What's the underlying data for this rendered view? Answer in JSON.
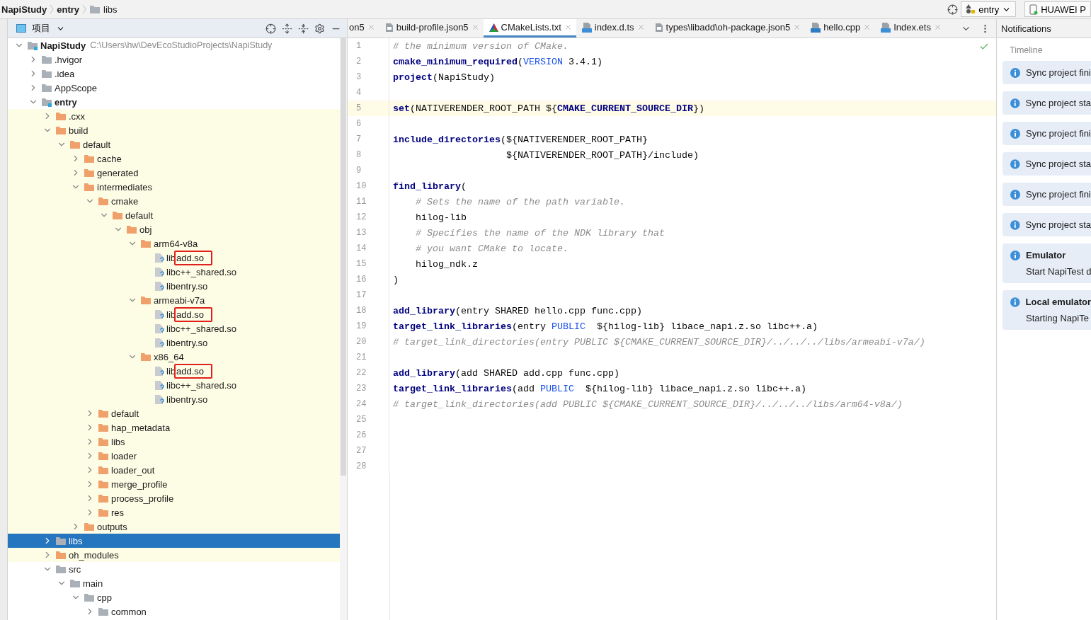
{
  "breadcrumb": [
    {
      "label": "NapiStudy",
      "kind": "text"
    },
    {
      "label": "entry",
      "kind": "text"
    },
    {
      "label": "libs",
      "kind": "folder"
    }
  ],
  "run_config": {
    "label": "entry"
  },
  "device": {
    "label": "HUAWEI P"
  },
  "project_panel": {
    "title": "项目",
    "tree": [
      {
        "label": "NapiStudy",
        "kind": "project",
        "path": "C:\\Users\\hw\\DevEcoStudioProjects\\NapiStudy",
        "expanded": true,
        "children": [
          {
            "label": ".hvigor",
            "kind": "folder",
            "expanded": false
          },
          {
            "label": ".idea",
            "kind": "folder",
            "expanded": false
          },
          {
            "label": "AppScope",
            "kind": "folder",
            "expanded": false
          },
          {
            "label": "entry",
            "kind": "module",
            "expanded": true,
            "children": [
              {
                "label": ".cxx",
                "kind": "excluded",
                "highlighted": true,
                "expanded": false
              },
              {
                "label": "build",
                "kind": "excluded",
                "highlighted": true,
                "expanded": true,
                "children": [
                  {
                    "label": "default",
                    "kind": "excluded",
                    "expanded": true,
                    "children": [
                      {
                        "label": "cache",
                        "kind": "excluded",
                        "expanded": false
                      },
                      {
                        "label": "generated",
                        "kind": "excluded",
                        "expanded": false
                      },
                      {
                        "label": "intermediates",
                        "kind": "excluded",
                        "expanded": true,
                        "children": [
                          {
                            "label": "cmake",
                            "kind": "excluded",
                            "expanded": true,
                            "children": [
                              {
                                "label": "default",
                                "kind": "excluded",
                                "expanded": true,
                                "children": [
                                  {
                                    "label": "obj",
                                    "kind": "excluded",
                                    "expanded": true,
                                    "children": [
                                      {
                                        "label": "arm64-v8a",
                                        "kind": "excluded",
                                        "expanded": true,
                                        "children": [
                                          {
                                            "label": "lib",
                                            "boxed": "add.so",
                                            "kind": "file"
                                          },
                                          {
                                            "label": "libc++_shared.so",
                                            "kind": "file"
                                          },
                                          {
                                            "label": "libentry.so",
                                            "kind": "file"
                                          }
                                        ]
                                      },
                                      {
                                        "label": "armeabi-v7a",
                                        "kind": "excluded",
                                        "expanded": true,
                                        "children": [
                                          {
                                            "label": "lib",
                                            "boxed": "add.so",
                                            "kind": "file"
                                          },
                                          {
                                            "label": "libc++_shared.so",
                                            "kind": "file"
                                          },
                                          {
                                            "label": "libentry.so",
                                            "kind": "file"
                                          }
                                        ]
                                      },
                                      {
                                        "label": "x86_64",
                                        "kind": "excluded",
                                        "expanded": true,
                                        "children": [
                                          {
                                            "label": "lib",
                                            "boxed": "add.so",
                                            "kind": "file"
                                          },
                                          {
                                            "label": "libc++_shared.so",
                                            "kind": "file"
                                          },
                                          {
                                            "label": "libentry.so",
                                            "kind": "file"
                                          }
                                        ]
                                      }
                                    ]
                                  }
                                ]
                              }
                            ]
                          },
                          {
                            "label": "default",
                            "kind": "excluded",
                            "expanded": false
                          },
                          {
                            "label": "hap_metadata",
                            "kind": "excluded",
                            "expanded": false
                          },
                          {
                            "label": "libs",
                            "kind": "excluded",
                            "expanded": false
                          },
                          {
                            "label": "loader",
                            "kind": "excluded",
                            "expanded": false
                          },
                          {
                            "label": "loader_out",
                            "kind": "excluded",
                            "expanded": false
                          },
                          {
                            "label": "merge_profile",
                            "kind": "excluded",
                            "expanded": false
                          },
                          {
                            "label": "process_profile",
                            "kind": "excluded",
                            "expanded": false
                          },
                          {
                            "label": "res",
                            "kind": "excluded",
                            "expanded": false
                          }
                        ]
                      },
                      {
                        "label": "outputs",
                        "kind": "excluded",
                        "expanded": false
                      }
                    ]
                  }
                ]
              },
              {
                "label": "libs",
                "kind": "folder",
                "expanded": false,
                "selected": true
              },
              {
                "label": "oh_modules",
                "kind": "excluded",
                "highlighted": true,
                "expanded": false
              },
              {
                "label": "src",
                "kind": "folder",
                "expanded": true,
                "children": [
                  {
                    "label": "main",
                    "kind": "folder",
                    "expanded": true,
                    "children": [
                      {
                        "label": "cpp",
                        "kind": "folder",
                        "expanded": true,
                        "children": [
                          {
                            "label": "common",
                            "kind": "folder",
                            "expanded": false
                          }
                        ]
                      }
                    ]
                  }
                ]
              }
            ]
          }
        ]
      }
    ]
  },
  "editor_tabs": [
    {
      "label": "on5",
      "kind": "plain",
      "selected": false
    },
    {
      "label": "build-profile.json5",
      "kind": "json",
      "selected": false
    },
    {
      "label": "CMakeLists.txt",
      "kind": "cmake",
      "selected": true
    },
    {
      "label": "index.d.ts",
      "kind": "ts",
      "selected": false
    },
    {
      "label": "types\\libadd\\oh-package.json5",
      "kind": "json",
      "selected": false
    },
    {
      "label": "hello.cpp",
      "kind": "cpp",
      "selected": false
    },
    {
      "label": "Index.ets",
      "kind": "ets",
      "selected": false
    }
  ],
  "code": [
    {
      "number": "1",
      "tokens": [
        {
          "t": "# the minimum version of CMake.",
          "kind": "comment"
        }
      ]
    },
    {
      "number": "2",
      "tokens": [
        {
          "t": "cmake_minimum_required",
          "kind": "keyword"
        },
        {
          "t": "(",
          "kind": "text"
        },
        {
          "t": "VERSION",
          "kind": "constant"
        },
        {
          "t": " 3.4.1)",
          "kind": "text"
        }
      ]
    },
    {
      "number": "3",
      "tokens": [
        {
          "t": "project",
          "kind": "keyword"
        },
        {
          "t": "(NapiStudy)",
          "kind": "text"
        }
      ]
    },
    {
      "number": "4"
    },
    {
      "number": "5",
      "current": true,
      "tokens": [
        {
          "t": "set",
          "kind": "keyword"
        },
        {
          "t": "(NATIVERENDER_ROOT_PATH ${",
          "kind": "text"
        },
        {
          "t": "CMAKE_CURRENT_SOURCE_DIR",
          "kind": "variable"
        },
        {
          "t": "})",
          "kind": "text"
        }
      ]
    },
    {
      "number": "6"
    },
    {
      "number": "7",
      "tokens": [
        {
          "t": "include_directories",
          "kind": "keyword"
        },
        {
          "t": "(${NATIVERENDER_ROOT_PATH}",
          "kind": "text"
        }
      ]
    },
    {
      "number": "8",
      "tokens": [
        {
          "t": "                    ${NATIVERENDER_ROOT_PATH}/include)",
          "kind": "text"
        }
      ]
    },
    {
      "number": "9"
    },
    {
      "number": "10",
      "tokens": [
        {
          "t": "find_library",
          "kind": "keyword"
        },
        {
          "t": "(",
          "kind": "text"
        }
      ]
    },
    {
      "number": "11",
      "tokens": [
        {
          "t": "    # Sets the name of the path variable.",
          "kind": "comment"
        }
      ]
    },
    {
      "number": "12",
      "tokens": [
        {
          "t": "    hilog-lib",
          "kind": "text"
        }
      ]
    },
    {
      "number": "13",
      "tokens": [
        {
          "t": "    # Specifies the name of the NDK library that",
          "kind": "comment"
        }
      ]
    },
    {
      "number": "14",
      "tokens": [
        {
          "t": "    # you want CMake to locate.",
          "kind": "comment"
        }
      ]
    },
    {
      "number": "15",
      "tokens": [
        {
          "t": "    hilog_ndk.z",
          "kind": "text"
        }
      ]
    },
    {
      "number": "16",
      "tokens": [
        {
          "t": ")",
          "kind": "text"
        }
      ]
    },
    {
      "number": "17"
    },
    {
      "number": "18",
      "tokens": [
        {
          "t": "add_library",
          "kind": "keyword"
        },
        {
          "t": "(entry SHARED hello.cpp func.cpp)",
          "kind": "text"
        }
      ]
    },
    {
      "number": "19",
      "tokens": [
        {
          "t": "target_link_libraries",
          "kind": "keyword"
        },
        {
          "t": "(entry ",
          "kind": "text"
        },
        {
          "t": "PUBLIC",
          "kind": "constant"
        },
        {
          "t": "  ${hilog-lib} libace_napi.z.so libc++.a)",
          "kind": "text"
        }
      ]
    },
    {
      "number": "20",
      "tokens": [
        {
          "t": "# target_link_directories(entry PUBLIC ${CMAKE_CURRENT_SOURCE_DIR}/../../../libs/armeabi-v7a/)",
          "kind": "comment"
        }
      ]
    },
    {
      "number": "21"
    },
    {
      "number": "22",
      "tokens": [
        {
          "t": "add_library",
          "kind": "keyword"
        },
        {
          "t": "(add SHARED add.cpp func.cpp)",
          "kind": "text"
        }
      ]
    },
    {
      "number": "23",
      "tokens": [
        {
          "t": "target_link_libraries",
          "kind": "keyword"
        },
        {
          "t": "(add ",
          "kind": "text"
        },
        {
          "t": "PUBLIC",
          "kind": "constant"
        },
        {
          "t": "  ${hilog-lib} libace_napi.z.so libc++.a)",
          "kind": "text"
        }
      ]
    },
    {
      "number": "24",
      "tokens": [
        {
          "t": "# target_link_directories(add PUBLIC ${CMAKE_CURRENT_SOURCE_DIR}/../../../libs/arm64-v8a/)",
          "kind": "comment"
        }
      ]
    },
    {
      "number": "25"
    },
    {
      "number": "26"
    },
    {
      "number": "27"
    },
    {
      "number": "28"
    }
  ],
  "notifications": {
    "title": "Notifications",
    "section": "Timeline",
    "items": [
      {
        "text": "Sync project fini"
      },
      {
        "text": "Sync project sta"
      },
      {
        "text": "Sync project fini"
      },
      {
        "text": "Sync project sta"
      },
      {
        "text": "Sync project fini"
      },
      {
        "text": "Sync project sta"
      },
      {
        "title": "Emulator",
        "text": "Start NapiTest d"
      },
      {
        "title": "Local emulator",
        "text": "Starting NapiTe"
      }
    ]
  }
}
